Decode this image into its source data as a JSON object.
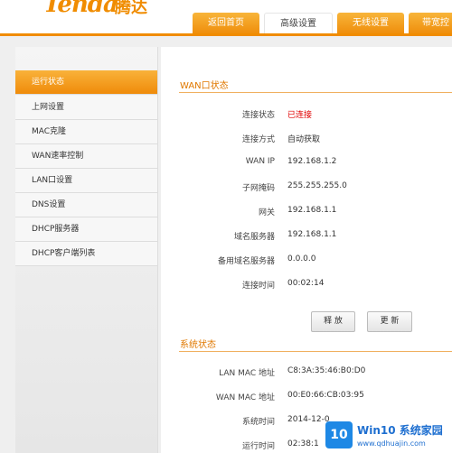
{
  "brand": {
    "logo": "Tenda",
    "logo_cn": "腾达"
  },
  "tabs": [
    {
      "label": "返回首页"
    },
    {
      "label": "高级设置"
    },
    {
      "label": "无线设置"
    },
    {
      "label": "带宽控"
    }
  ],
  "sidebar": {
    "items": [
      {
        "label": "运行状态"
      },
      {
        "label": "上网设置"
      },
      {
        "label": "MAC克隆"
      },
      {
        "label": "WAN速率控制"
      },
      {
        "label": "LAN口设置"
      },
      {
        "label": "DNS设置"
      },
      {
        "label": "DHCP服务器"
      },
      {
        "label": "DHCP客户端列表"
      }
    ]
  },
  "wan": {
    "title": "WAN口状态",
    "rows": [
      {
        "label": "连接状态",
        "value": "已连接"
      },
      {
        "label": "连接方式",
        "value": "自动获取"
      },
      {
        "label": "WAN IP",
        "value": "192.168.1.2"
      },
      {
        "label": "子网掩码",
        "value": "255.255.255.0"
      },
      {
        "label": "网关",
        "value": "192.168.1.1"
      },
      {
        "label": "域名服务器",
        "value": "192.168.1.1"
      },
      {
        "label": "备用域名服务器",
        "value": "0.0.0.0"
      },
      {
        "label": "连接时间",
        "value": "00:02:14"
      }
    ],
    "release_label": "释 放",
    "renew_label": "更 新"
  },
  "system": {
    "title": "系统状态",
    "rows": [
      {
        "label": "LAN MAC 地址",
        "value": "C8:3A:35:46:B0:D0"
      },
      {
        "label": "WAN MAC 地址",
        "value": "00:E0:66:CB:03:95"
      },
      {
        "label": "系统时间",
        "value": "2014-12-0"
      },
      {
        "label": "运行时间",
        "value": "02:38:1"
      }
    ]
  },
  "watermark": {
    "box": "10",
    "text1": "Win10 系统家园",
    "text2": "www.qdhuajin.com"
  },
  "colors": {
    "accent": "#f08c00",
    "connected": "#e00000"
  }
}
